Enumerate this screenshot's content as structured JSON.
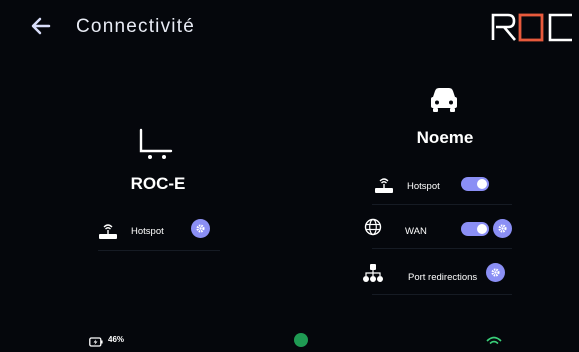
{
  "header": {
    "title": "Connectivité",
    "back_icon": "arrow-left-icon",
    "logo_text": "ROC"
  },
  "colors": {
    "background": "#05070c",
    "accent": "#8b8ff5",
    "logo_accent": "#e85a3c",
    "status_green": "#1f9a53"
  },
  "left_device": {
    "name": "ROC-E",
    "icon": "cart-icon",
    "rows": [
      {
        "label": "Hotspot",
        "icon": "router-wifi-icon",
        "has_toggle": false,
        "has_gear": true
      }
    ]
  },
  "right_device": {
    "name": "Noeme",
    "icon": "car-icon",
    "rows": [
      {
        "label": "Hotspot",
        "icon": "router-wifi-icon",
        "toggle_on": true,
        "has_gear": false
      },
      {
        "label": "WAN",
        "icon": "globe-icon",
        "toggle_on": true,
        "has_gear": true
      },
      {
        "label": "Port redirections",
        "icon": "network-icon",
        "has_toggle": false,
        "has_gear": true
      }
    ]
  },
  "status_bar": {
    "battery": "46%"
  }
}
